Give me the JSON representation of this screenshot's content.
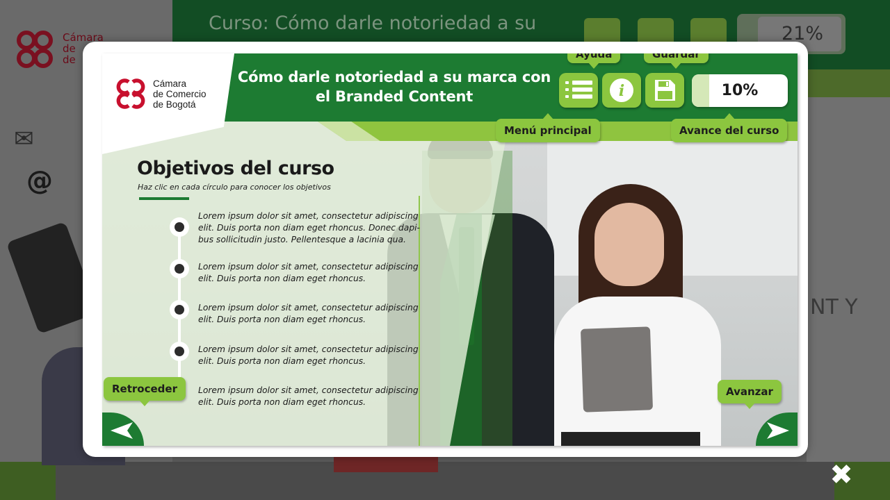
{
  "background": {
    "title": "Curso: Cómo darle notoriedad a su",
    "progress": "21%",
    "logo_lines": [
      "Cámara",
      "de",
      "de"
    ],
    "side_text": "NT Y"
  },
  "header": {
    "logo_lines": [
      "Cámara",
      "de Comercio",
      "de Bogotá"
    ],
    "course_title": "Cómo darle notoriedad a su marca con el Branded Content",
    "buttons": {
      "menu_icon": "list-icon",
      "help_icon": "info-icon",
      "save_icon": "floppy-disk-icon"
    },
    "tooltips": {
      "help": "Ayuda",
      "save": "Guardar",
      "menu": "Menú principal",
      "progress": "Avance del curso"
    },
    "progress": {
      "label": "10%",
      "value": 0.1
    }
  },
  "content": {
    "title": "Objetivos del curso",
    "subtitle": "Haz clic en cada círculo para conocer los objetivos",
    "objectives": [
      "Lorem ipsum dolor sit amet, consectetur adipiscing elit. Duis porta non diam eget rhoncus. Donec dapi- bus sollicitudin justo. Pellentesque a lacinia qua.",
      "Lorem ipsum dolor sit amet, consectetur adipiscing elit. Duis porta non diam eget rhoncus.",
      "Lorem ipsum dolor sit amet, consectetur adipiscing elit. Duis porta non diam eget rhoncus.",
      "Lorem ipsum dolor sit amet, consectetur adipiscing elit. Duis porta non diam eget rhoncus.",
      "Lorem ipsum dolor sit amet, consectetur adipiscing elit. Duis porta non diam eget rhoncus."
    ]
  },
  "navigation": {
    "back_label": "Retroceder",
    "next_label": "Avanzar",
    "back_icon": "arrow-left-icon",
    "next_icon": "arrow-right-icon",
    "close_icon": "close-icon",
    "close_glyph": "✖"
  },
  "colors": {
    "brand_green": "#1d7b32",
    "accent_green": "#8cc63f",
    "logo_red": "#c8102e"
  }
}
